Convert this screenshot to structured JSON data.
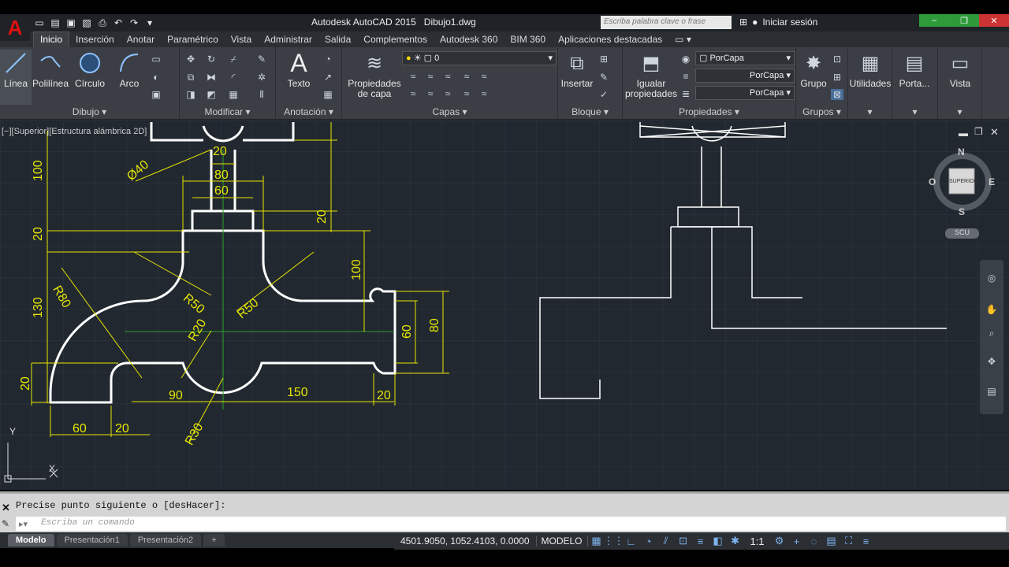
{
  "app": {
    "logo": "A",
    "title": "Autodesk AutoCAD 2015",
    "file": "Dibujo1.dwg"
  },
  "search": {
    "placeholder": "Escriba palabra clave o frase"
  },
  "user": {
    "signin": "Iniciar sesión"
  },
  "tabs": [
    "Inicio",
    "Inserción",
    "Anotar",
    "Paramétrico",
    "Vista",
    "Administrar",
    "Salida",
    "Complementos",
    "Autodesk 360",
    "BIM 360",
    "Aplicaciones destacadas"
  ],
  "ribbon": {
    "linea": "Línea",
    "polilinea": "Polilínea",
    "circulo": "Círculo",
    "arco": "Arco",
    "dibujo_panel": "Dibujo",
    "modificar_panel": "Modificar",
    "texto": "Texto",
    "anotacion_panel": "Anotación",
    "prop_capa_1": "Propiedades",
    "prop_capa_2": "de capa",
    "capas_panel": "Capas",
    "layer_value": "0",
    "insertar": "Insertar",
    "bloque_panel": "Bloque",
    "igualar_1": "Igualar",
    "igualar_2": "propiedades",
    "propiedades_panel": "Propiedades",
    "porcapa_color": "PorCapa",
    "porcapa_linetype": "PorCapa",
    "porcapa_lineweight": "PorCapa",
    "grupo": "Grupo",
    "grupos_panel": "Grupos",
    "utilidades": "Utilidades",
    "portapapeles": "Porta...",
    "vista": "Vista"
  },
  "viewport": {
    "label": "[−][Superior][Estructura alámbrica 2D]",
    "navcube": {
      "n": "N",
      "s": "S",
      "e": "E",
      "o": "O",
      "face": "SUPERIOR",
      "ucs": "SCU"
    },
    "ucs_x": "X",
    "ucs_y": "Y",
    "dims": [
      "20",
      "80",
      "60",
      "100",
      "20",
      "20",
      "Ø40",
      "R80",
      "R50",
      "R50",
      "100",
      "130",
      "R20",
      "60",
      "80",
      "20",
      "90",
      "150",
      "20",
      "60",
      "20",
      "R30"
    ]
  },
  "command": {
    "history": "Precise punto siguiente o [desHacer]:",
    "placeholder": "Escriba un comando"
  },
  "layout_tabs": [
    "Modelo",
    "Presentación1",
    "Presentación2"
  ],
  "status": {
    "coords": "4501.9050, 1052.4103, 0.0000",
    "model": "MODELO",
    "scale": "1:1"
  },
  "colors": {
    "dimension": "#e6e600",
    "geometry": "#ffffff",
    "viewport_bg": "#212830",
    "center": "#2aa02a"
  }
}
